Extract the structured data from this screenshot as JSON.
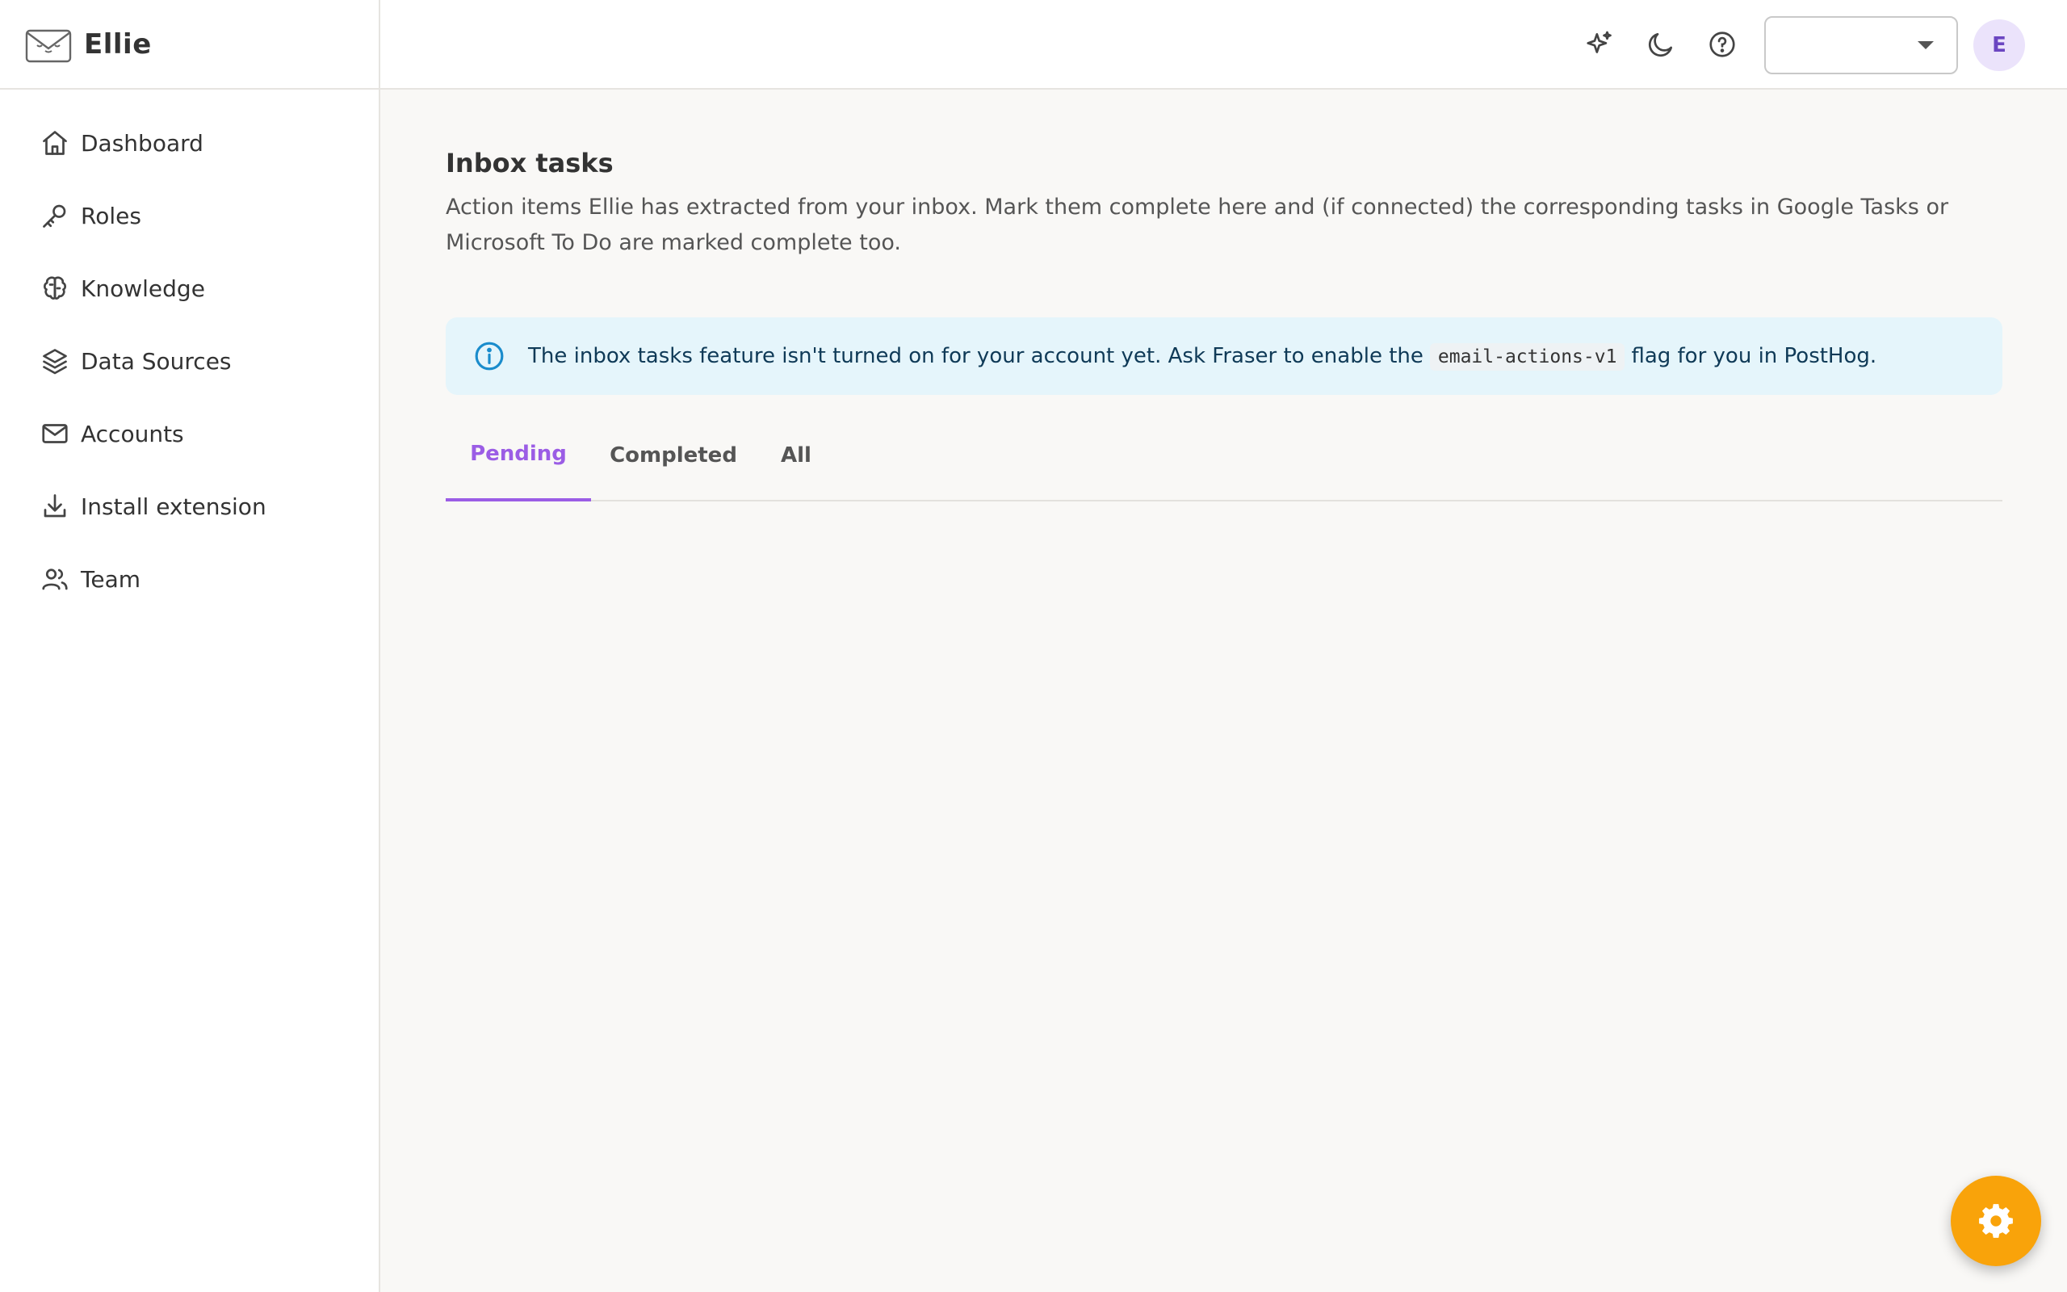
{
  "brand": {
    "name": "Ellie"
  },
  "sidebar": {
    "items": [
      {
        "label": "Dashboard",
        "icon": "home-icon"
      },
      {
        "label": "Roles",
        "icon": "key-icon"
      },
      {
        "label": "Knowledge",
        "icon": "brain-icon"
      },
      {
        "label": "Data Sources",
        "icon": "layers-icon"
      },
      {
        "label": "Accounts",
        "icon": "mail-icon"
      },
      {
        "label": "Install extension",
        "icon": "download-icon"
      },
      {
        "label": "Team",
        "icon": "users-icon"
      }
    ]
  },
  "header": {
    "select_value": "",
    "avatar_initial": "E",
    "icons": [
      "sparkles-icon",
      "moon-icon",
      "help-icon",
      "chevron-down-icon"
    ]
  },
  "main": {
    "title": "Inbox tasks",
    "description": "Action items Ellie has extracted from your inbox. Mark them complete here and (if connected) the corresponding tasks in Google Tasks or Microsoft To Do are marked complete too.",
    "banner": {
      "text_before": "The inbox tasks feature isn't turned on for your account yet. Ask Fraser to enable the",
      "code": "email-actions-v1",
      "text_after": "flag for you in PostHog."
    },
    "tabs": [
      {
        "label": "Pending",
        "active": true
      },
      {
        "label": "Completed",
        "active": false
      },
      {
        "label": "All",
        "active": false
      }
    ]
  },
  "colors": {
    "accent": "#9b5de5",
    "fab": "#f9a30a",
    "banner_bg": "#e5f5fb",
    "info_icon": "#1a8ccc"
  }
}
